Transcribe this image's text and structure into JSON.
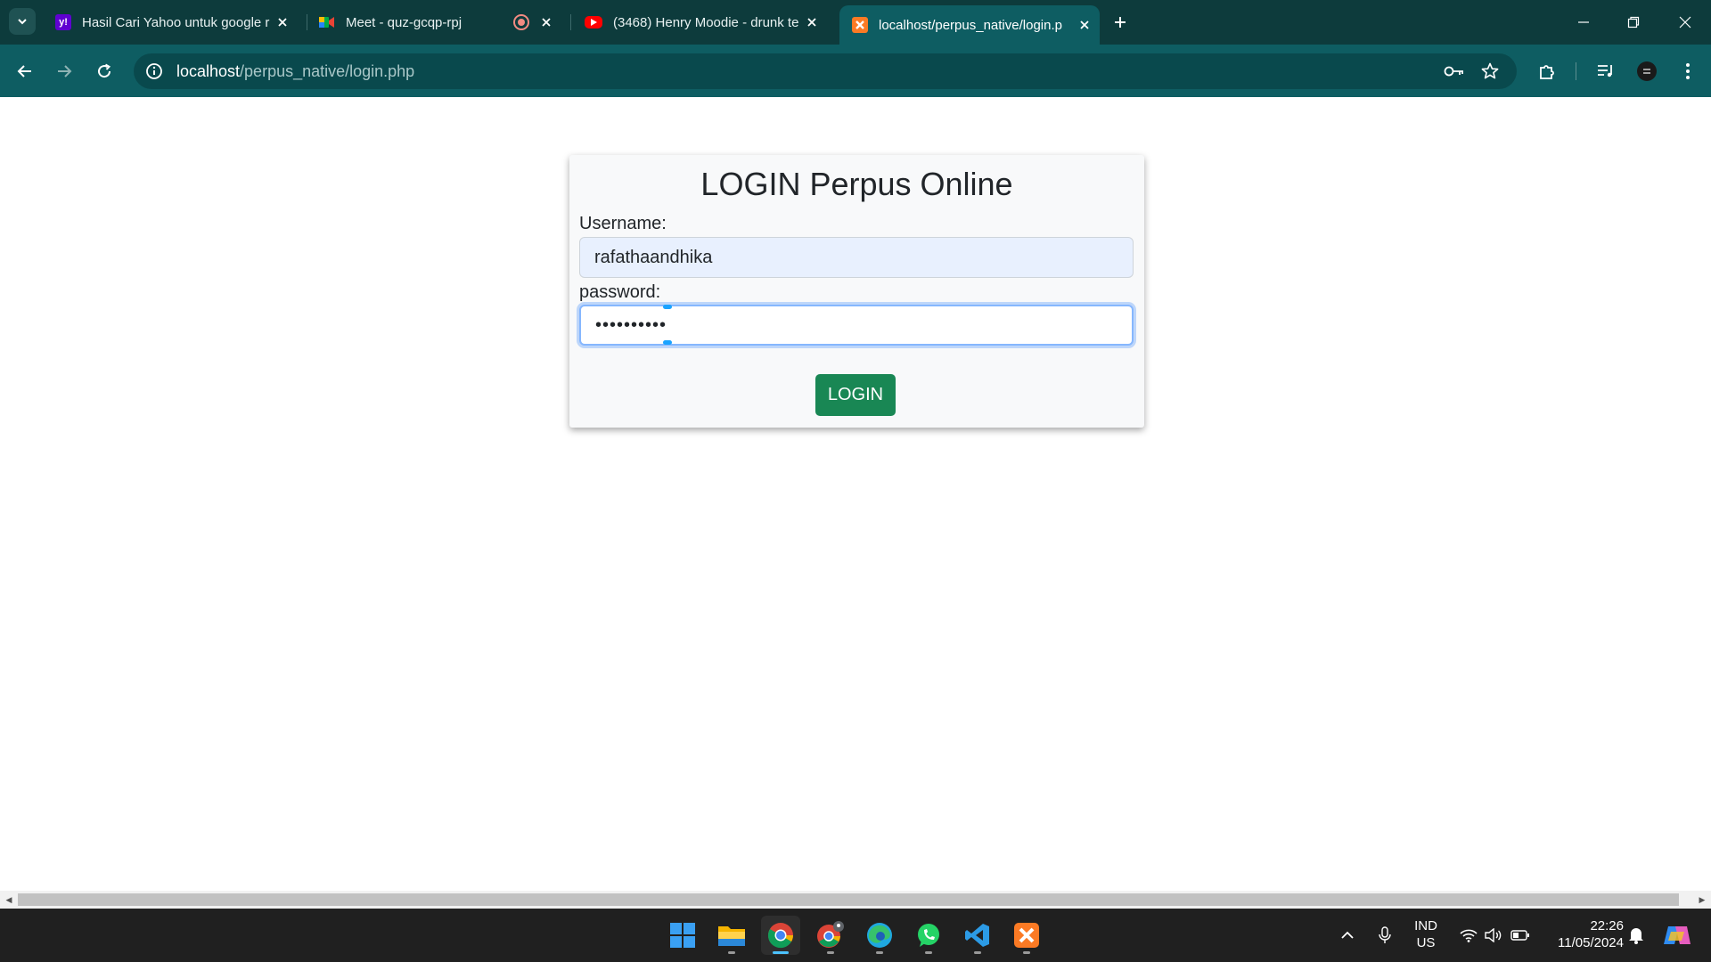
{
  "browser": {
    "tabs": [
      {
        "title": "Hasil Cari Yahoo untuk google r",
        "favicon": "yahoo-icon",
        "active": false
      },
      {
        "title": "Meet - quz-gcqp-rpj",
        "favicon": "google-meet-icon",
        "active": false,
        "recording": true
      },
      {
        "title": "(3468) Henry Moodie - drunk te",
        "favicon": "youtube-icon",
        "active": false
      },
      {
        "title": "localhost/perpus_native/login.p",
        "favicon": "xampp-icon",
        "active": true
      }
    ],
    "address": {
      "host": "localhost",
      "path": "/perpus_native/login.php"
    }
  },
  "page": {
    "title": "LOGIN Perpus Online",
    "username_label": "Username:",
    "username_value": "rafathaandhika",
    "password_label": "password:",
    "password_value": "••••••••••",
    "login_button": "LOGIN"
  },
  "taskbar": {
    "apps": [
      "windows-start-icon",
      "file-explorer-icon",
      "chrome-icon",
      "chrome-profile-icon",
      "edge-icon",
      "whatsapp-icon",
      "vscode-icon",
      "xampp-icon"
    ],
    "language": {
      "line1": "IND",
      "line2": "US"
    },
    "time": "22:26",
    "date": "11/05/2024"
  },
  "colors": {
    "tab_strip": "#0d3b3c",
    "toolbar": "#0e5d62",
    "login_button": "#198754",
    "focus_ring": "#86b7fe"
  }
}
